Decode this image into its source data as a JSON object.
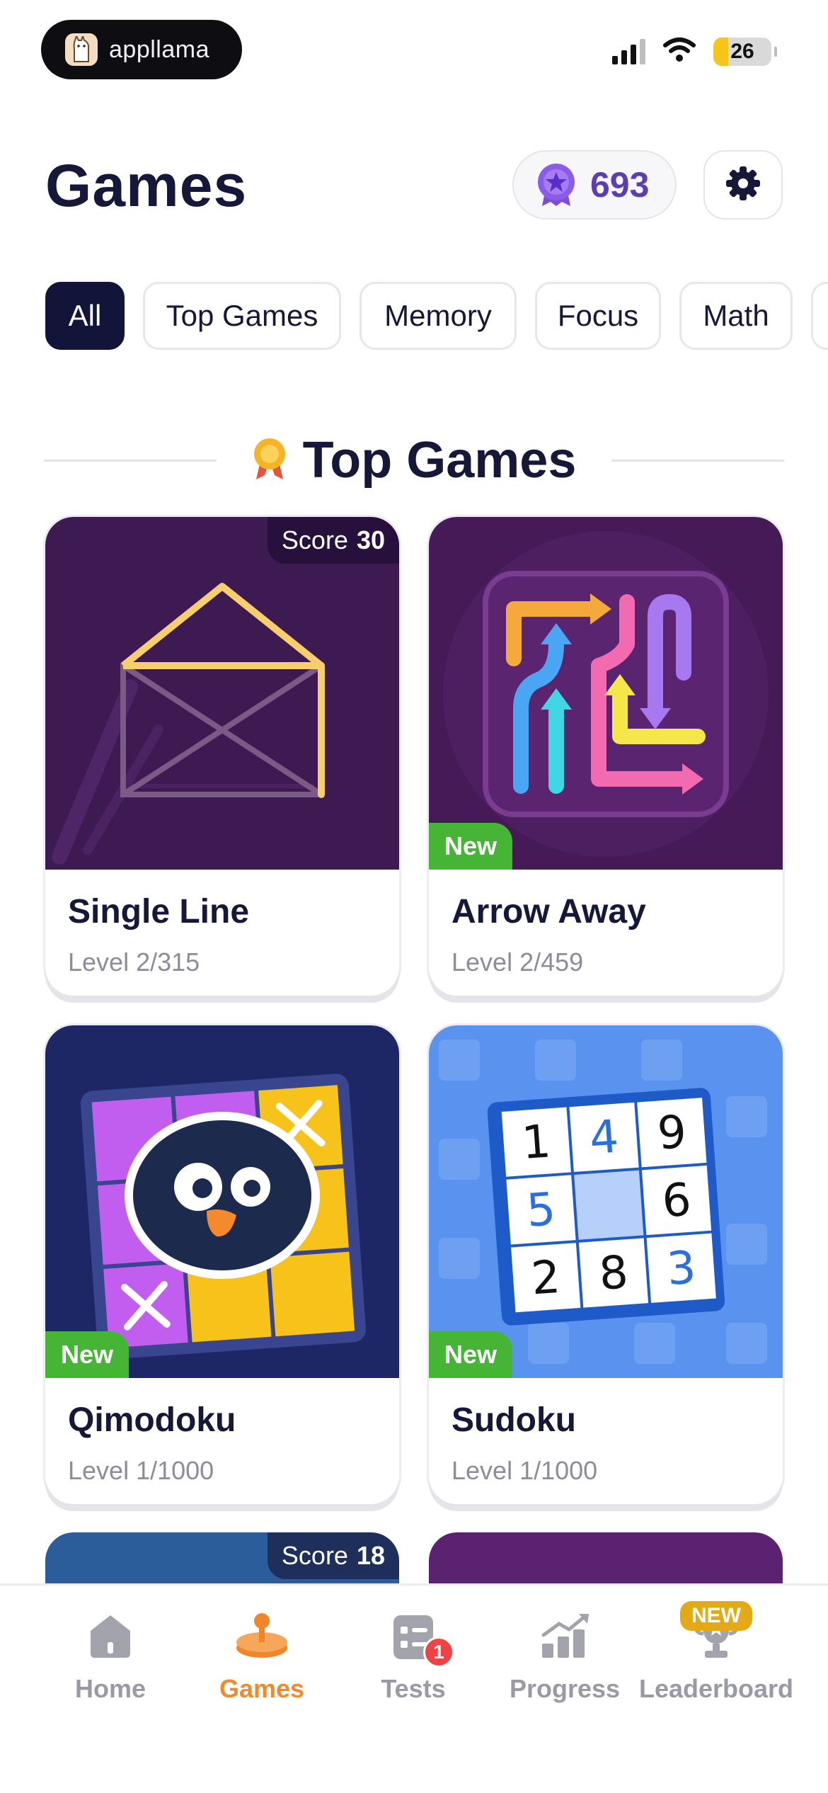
{
  "status_bar": {
    "app_brand": "appllama",
    "battery": "26"
  },
  "header": {
    "title": "Games",
    "points": "693"
  },
  "filters": [
    "All",
    "Top Games",
    "Memory",
    "Focus",
    "Math"
  ],
  "section": {
    "title": "Top Games"
  },
  "games": [
    {
      "name": "Single Line",
      "level": "Level 2/315",
      "score_label": "Score",
      "score": "30"
    },
    {
      "name": "Arrow Away",
      "level": "Level 2/459",
      "badge": "New"
    },
    {
      "name": "Qimodoku",
      "level": "Level 1/1000",
      "badge": "New"
    },
    {
      "name": "Sudoku",
      "level": "Level 1/1000",
      "badge": "New"
    }
  ],
  "partial_card": {
    "score_label": "Score",
    "score": "18"
  },
  "sudoku_digits": [
    "1",
    "4",
    "9",
    "5",
    "",
    "6",
    "2",
    "8",
    "3"
  ],
  "nav": {
    "items": [
      {
        "label": "Home"
      },
      {
        "label": "Games"
      },
      {
        "label": "Tests",
        "badge": "1"
      },
      {
        "label": "Progress"
      },
      {
        "label": "Leaderboard",
        "tag": "NEW"
      }
    ],
    "active_index": 1
  },
  "colors": {
    "primary_dark": "#16183a",
    "accent_orange": "#f08a2c",
    "points_purple": "#5b3fb0",
    "new_green": "#46b535",
    "card_purple": "#3e1a52",
    "sudoku_blue": "#5a92ef"
  }
}
